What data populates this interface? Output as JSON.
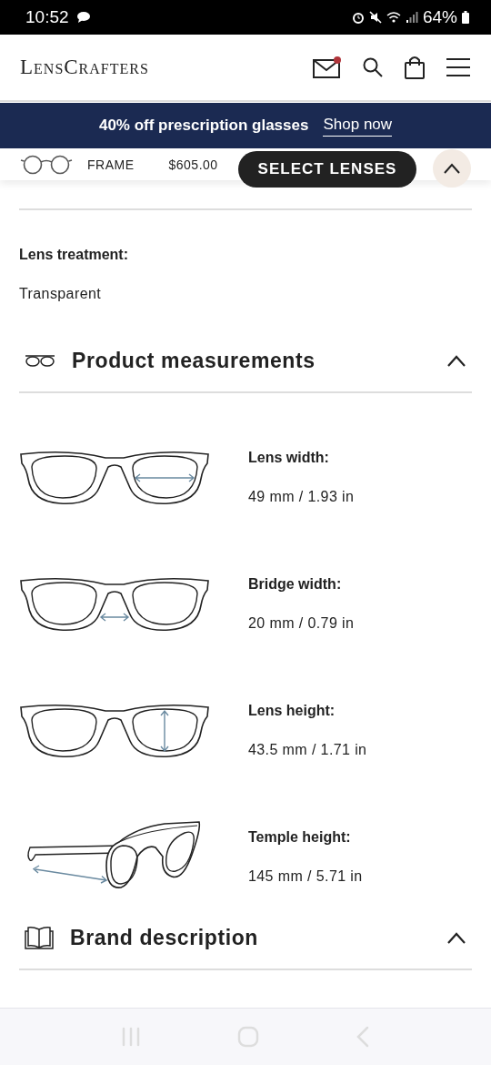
{
  "status_bar": {
    "time": "10:52",
    "battery": "64%"
  },
  "header": {
    "logo": "LensCrafters",
    "has_unread_mail": true
  },
  "promo": {
    "text": "40% off prescription glasses",
    "link": "Shop now"
  },
  "sticky_bar": {
    "label": "FRAME",
    "price": "$605.00",
    "button": "SELECT LENSES",
    "expanded": true
  },
  "lens_information": {
    "fields": [
      {
        "label": "Lens treatment:",
        "value": "Transparent"
      }
    ]
  },
  "product_measurements": {
    "title": "Product measurements",
    "expanded": true,
    "items": [
      {
        "kind": "lens-width",
        "label": "Lens width:",
        "value": "49 mm / 1.93 in"
      },
      {
        "kind": "bridge-width",
        "label": "Bridge width:",
        "value": "20 mm / 0.79 in"
      },
      {
        "kind": "lens-height",
        "label": "Lens height:",
        "value": "43.5 mm / 1.71 in"
      },
      {
        "kind": "temple-length",
        "label": "Temple height:",
        "value": "145 mm / 5.71 in"
      }
    ]
  },
  "brand_description": {
    "title": "Brand description",
    "expanded": true
  }
}
